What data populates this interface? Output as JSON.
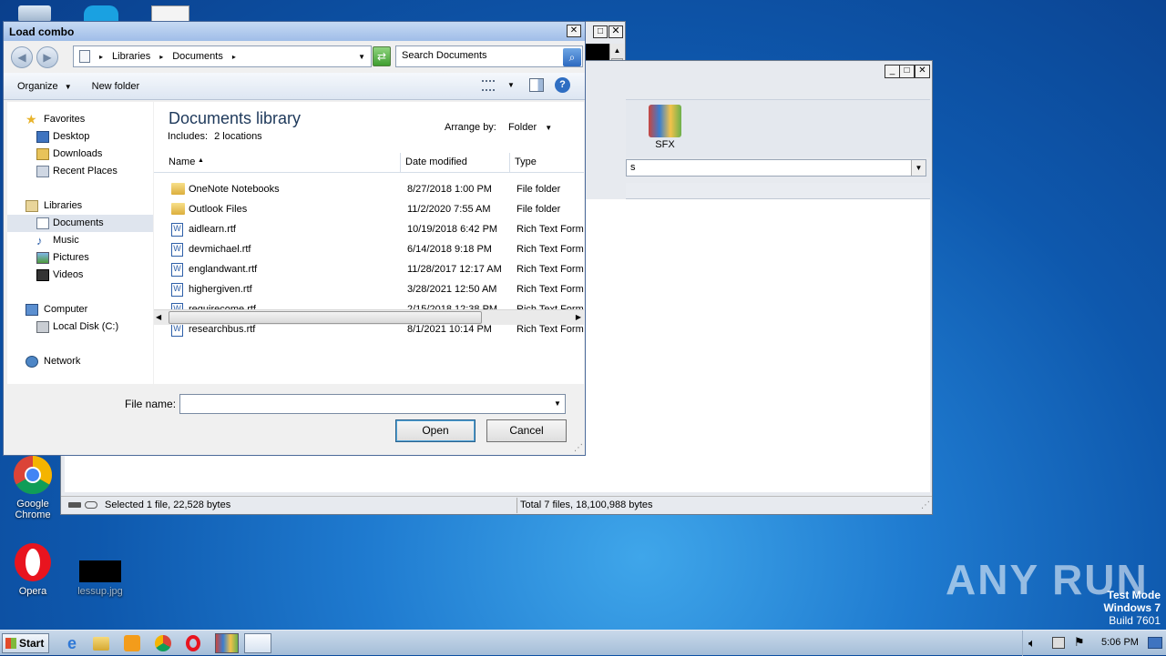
{
  "desktop": {
    "icons": [
      {
        "label": "Google Chrome"
      },
      {
        "label": "Opera"
      },
      {
        "label": "lessup.jpg"
      }
    ],
    "watermark": {
      "brand": "ANY RUN",
      "line1": "Test Mode",
      "line2": "Windows 7",
      "line3": "Build 7601"
    }
  },
  "bg_window": {
    "sfx_label": "SFX",
    "combo_value": "s",
    "status_left": "Selected 1 file, 22,528 bytes",
    "status_right": "Total 7 files, 18,100,988 bytes"
  },
  "dialog": {
    "title": "Load combo",
    "breadcrumb": [
      "Libraries",
      "Documents"
    ],
    "search_placeholder": "Search Documents",
    "toolbar": {
      "organize": "Organize",
      "new_folder": "New folder"
    },
    "library_title": "Documents library",
    "includes_label": "Includes:",
    "includes_link": "2 locations",
    "arrange_label": "Arrange by:",
    "arrange_value": "Folder",
    "columns": {
      "name": "Name",
      "date": "Date modified",
      "type": "Type"
    },
    "files": [
      {
        "name": "OneNote Notebooks",
        "date": "8/27/2018 1:00 PM",
        "type": "File folder",
        "kind": "folder"
      },
      {
        "name": "Outlook Files",
        "date": "11/2/2020 7:55 AM",
        "type": "File folder",
        "kind": "folder"
      },
      {
        "name": "aidlearn.rtf",
        "date": "10/19/2018 6:42 PM",
        "type": "Rich Text Forma",
        "kind": "rtf"
      },
      {
        "name": "devmichael.rtf",
        "date": "6/14/2018 9:18 PM",
        "type": "Rich Text Forma",
        "kind": "rtf"
      },
      {
        "name": "englandwant.rtf",
        "date": "11/28/2017 12:17 AM",
        "type": "Rich Text Forma",
        "kind": "rtf"
      },
      {
        "name": "highergiven.rtf",
        "date": "3/28/2021 12:50 AM",
        "type": "Rich Text Forma",
        "kind": "rtf"
      },
      {
        "name": "requirecome.rtf",
        "date": "2/15/2018 12:38 PM",
        "type": "Rich Text Forma",
        "kind": "rtf"
      },
      {
        "name": "researchbus.rtf",
        "date": "8/1/2021 10:14 PM",
        "type": "Rich Text Forma",
        "kind": "rtf"
      }
    ],
    "nav": {
      "favorites": "Favorites",
      "desktop": "Desktop",
      "downloads": "Downloads",
      "recent": "Recent Places",
      "libraries": "Libraries",
      "documents": "Documents",
      "music": "Music",
      "pictures": "Pictures",
      "videos": "Videos",
      "computer": "Computer",
      "local_disk": "Local Disk (C:)",
      "network": "Network"
    },
    "filename_label": "File name:",
    "filename_value": "",
    "open_button": "Open",
    "cancel_button": "Cancel"
  },
  "taskbar": {
    "start_label": "Start",
    "clock": "5:06 PM"
  }
}
